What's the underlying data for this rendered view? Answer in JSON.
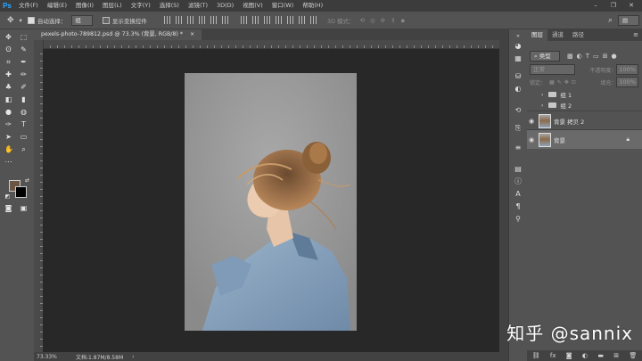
{
  "app": {
    "logo": "Ps"
  },
  "menu": [
    "文件(F)",
    "编辑(E)",
    "图像(I)",
    "图层(L)",
    "文字(Y)",
    "选择(S)",
    "滤镜(T)",
    "3D(D)",
    "视图(V)",
    "窗口(W)",
    "帮助(H)"
  ],
  "options_bar": {
    "auto_select_label": "自动选择：",
    "auto_select_value": "组",
    "show_transform_label": "显示变换控件",
    "mode_3d_label": "3D 模式："
  },
  "document_tab": {
    "title": "pexels-photo-789812.psd @ 73.3% (背景, RGB/8) *",
    "close": "×"
  },
  "status": {
    "zoom": "73.33%",
    "doc_info": "文档:1.87M/8.58M"
  },
  "layers_panel": {
    "tabs": [
      "图层",
      "通道",
      "路径"
    ],
    "filter_label": "类型",
    "blend_mode": "正常",
    "opacity_label": "不透明度：",
    "opacity_value": "100%",
    "lock_label": "锁定：",
    "fill_label": "填充：",
    "fill_value": "100%",
    "layers": [
      {
        "name": "组 1",
        "type": "group"
      },
      {
        "name": "组 2",
        "type": "group"
      },
      {
        "name": "背景 拷贝 2",
        "type": "pixel"
      },
      {
        "name": "背景",
        "type": "pixel",
        "selected": true
      }
    ]
  },
  "watermark": "知乎 @sannix"
}
